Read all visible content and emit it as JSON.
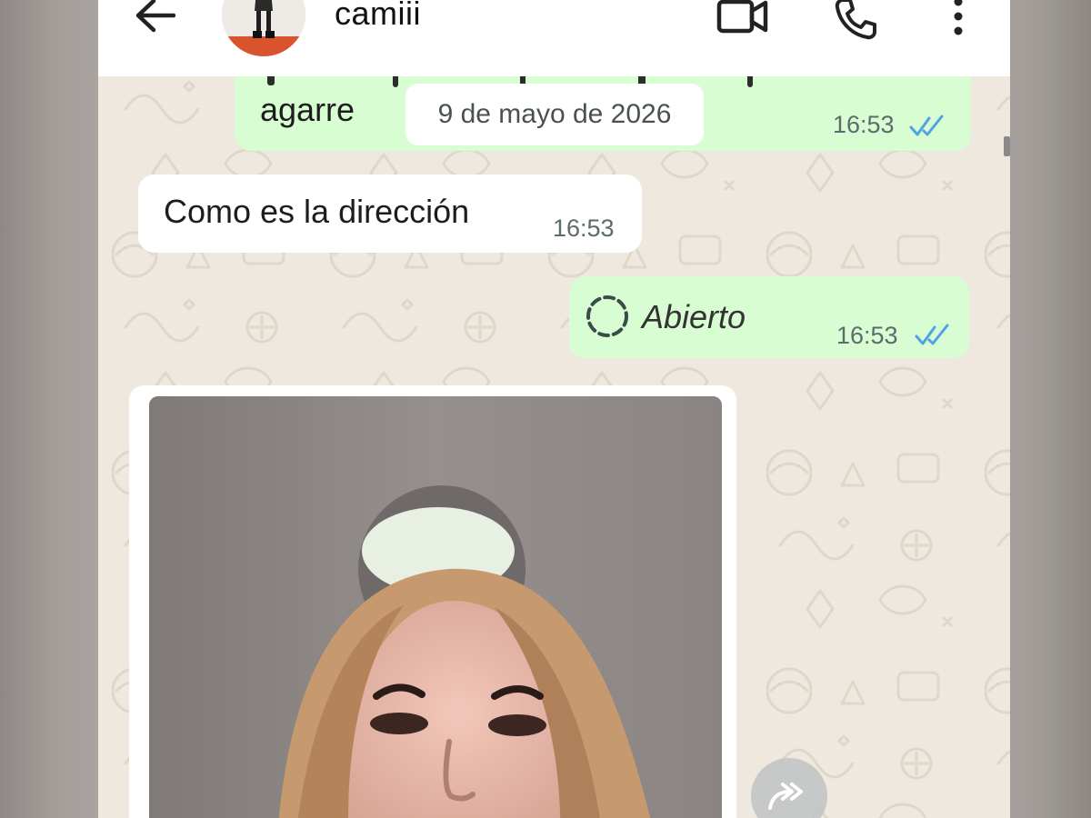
{
  "header": {
    "contact_name": "camiii",
    "icons": [
      "back-arrow-icon",
      "video-call-icon",
      "phone-icon",
      "more-options-icon"
    ]
  },
  "colors": {
    "outgoing_bubble": "#d9fdd3",
    "incoming_bubble": "#ffffff",
    "chat_background": "#efe8df",
    "read_ticks": "#4fa3e0"
  },
  "date_divider": "9 de mayo de 2026",
  "messages": [
    {
      "direction": "outgoing",
      "text": "agarre",
      "time": "16:53",
      "status": "read"
    },
    {
      "direction": "incoming",
      "text": "Como es la dirección",
      "time": "16:53"
    },
    {
      "direction": "outgoing",
      "kind": "view-once",
      "text": "Abierto",
      "time": "16:53",
      "status": "read"
    },
    {
      "direction": "incoming",
      "kind": "photo"
    }
  ]
}
